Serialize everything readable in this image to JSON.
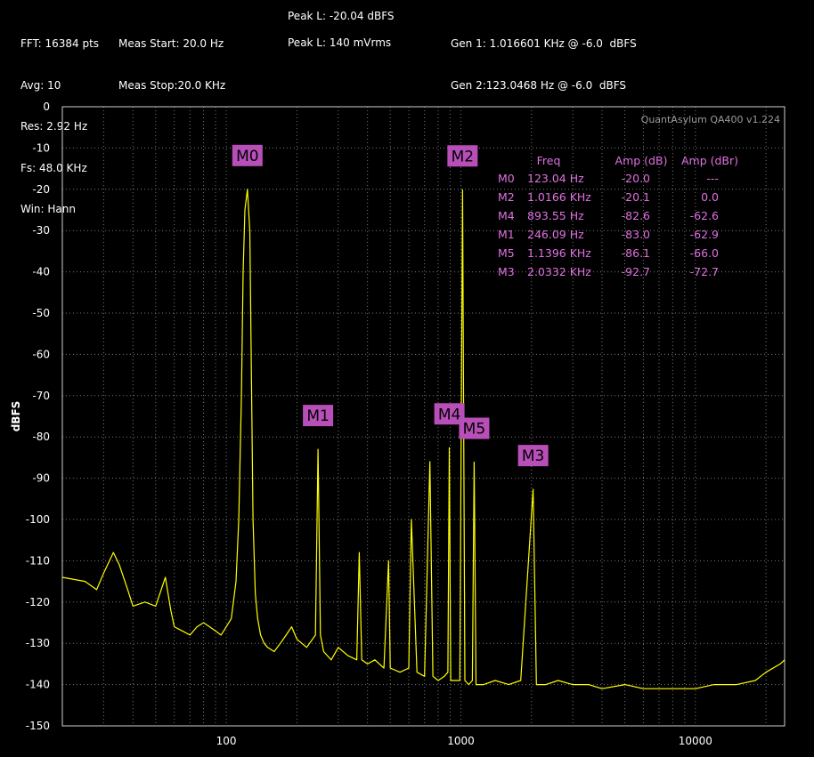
{
  "header": {
    "col1": [
      "FFT: 16384 pts",
      "Avg: 10",
      "Res: 2.92 Hz",
      "Fs: 48.0 KHz",
      "Win: Hann"
    ],
    "col2": [
      "Meas Start: 20.0 Hz",
      "Meas Stop:20.0 KHz"
    ],
    "peak_dbfs": "Peak L: -20.04 dBFS",
    "peak_vrms": "Peak L: 140 mVrms",
    "gen1": "Gen 1: 1.016601 KHz @ -6.0  dBFS",
    "gen2": "Gen 2:123.0468 Hz @ -6.0  dBFS"
  },
  "watermark": "QuantAsylum QA400 v1.224",
  "colors": {
    "trace": "#ffff00",
    "grid": "#7a7a7a",
    "marker": "#b84fb8",
    "table": "#e070e0"
  },
  "chart_data": {
    "type": "line",
    "xscale": "log",
    "xlim": [
      20,
      24000
    ],
    "ylim": [
      -150,
      0
    ],
    "ylabel": "dBFS",
    "xticks": [
      100,
      1000,
      10000
    ],
    "xtick_labels": [
      "100",
      "1000",
      "10000"
    ],
    "yticks": [
      0,
      -10,
      -20,
      -30,
      -40,
      -50,
      -60,
      -70,
      -80,
      -90,
      -100,
      -110,
      -120,
      -130,
      -140,
      -150
    ],
    "grid": true,
    "series": [
      {
        "x": [
          20,
          25,
          28,
          30,
          33,
          35,
          38,
          40,
          45,
          50,
          55,
          58,
          60,
          65,
          70,
          75,
          80,
          90,
          95,
          100,
          105,
          110,
          113,
          116,
          118,
          120,
          123,
          126,
          128,
          130,
          133,
          136,
          140,
          145,
          150,
          160,
          170,
          180,
          190,
          200,
          220,
          240,
          246,
          252,
          260,
          280,
          300,
          330,
          360,
          369,
          378,
          400,
          430,
          470,
          492,
          500,
          550,
          600,
          615,
          650,
          700,
          738,
          760,
          800,
          850,
          880,
          893,
          905,
          930,
          960,
          990,
          1016.6,
          1040,
          1080,
          1120,
          1139.6,
          1160,
          1250,
          1400,
          1600,
          1800,
          2033,
          2100,
          2300,
          2600,
          3000,
          3500,
          4000,
          5000,
          6000,
          8000,
          10000,
          12000,
          15000,
          18000,
          20000,
          23000,
          24000
        ],
        "y": [
          -114,
          -115,
          -117,
          -113,
          -108,
          -111,
          -117,
          -121,
          -120,
          -121,
          -114,
          -122,
          -126,
          -127,
          -128,
          -126,
          -125,
          -127,
          -128,
          -126,
          -124,
          -115,
          -100,
          -70,
          -40,
          -25,
          -20,
          -30,
          -65,
          -100,
          -118,
          -124,
          -128,
          -130,
          -131,
          -132,
          -130,
          -128,
          -126,
          -129,
          -131,
          -128,
          -83,
          -128,
          -132,
          -134,
          -131,
          -133,
          -134,
          -108,
          -134,
          -135,
          -134,
          -136,
          -110,
          -136,
          -137,
          -136,
          -100,
          -137,
          -138,
          -86,
          -138,
          -139,
          -138,
          -137,
          -82.6,
          -139,
          -139,
          -139,
          -139,
          -20.1,
          -139,
          -140,
          -139,
          -86.1,
          -140,
          -140,
          -139,
          -140,
          -139,
          -92.7,
          -140,
          -140,
          -139,
          -140,
          -140,
          -141,
          -140,
          -141,
          -141,
          -141,
          -140,
          -140,
          -139,
          -137,
          -135,
          -134
        ]
      }
    ],
    "markers": [
      {
        "label": "M0",
        "freq": 123.04,
        "amp": -20.0
      },
      {
        "label": "M1",
        "freq": 246.09,
        "amp": -83.0
      },
      {
        "label": "M2",
        "freq": 1016.6,
        "amp": -20.1
      },
      {
        "label": "M3",
        "freq": 2033.2,
        "amp": -92.7
      },
      {
        "label": "M4",
        "freq": 893.55,
        "amp": -82.6
      },
      {
        "label": "M5",
        "freq": 1139.6,
        "amp": -86.1
      }
    ],
    "table": {
      "headers": [
        "Freq",
        "Amp (dB)",
        "Amp (dBr)"
      ],
      "rows": [
        {
          "m": "M0",
          "freq": "123.04 Hz",
          "amp": "-20.0",
          "ampr": "---"
        },
        {
          "m": "M2",
          "freq": "1.0166 KHz",
          "amp": "-20.1",
          "ampr": "0.0"
        },
        {
          "m": "M4",
          "freq": "893.55 Hz",
          "amp": "-82.6",
          "ampr": "-62.6"
        },
        {
          "m": "M1",
          "freq": "246.09 Hz",
          "amp": "-83.0",
          "ampr": "-62.9"
        },
        {
          "m": "M5",
          "freq": "1.1396 KHz",
          "amp": "-86.1",
          "ampr": "-66.0"
        },
        {
          "m": "M3",
          "freq": "2.0332 KHz",
          "amp": "-92.7",
          "ampr": "-72.7"
        }
      ]
    }
  }
}
